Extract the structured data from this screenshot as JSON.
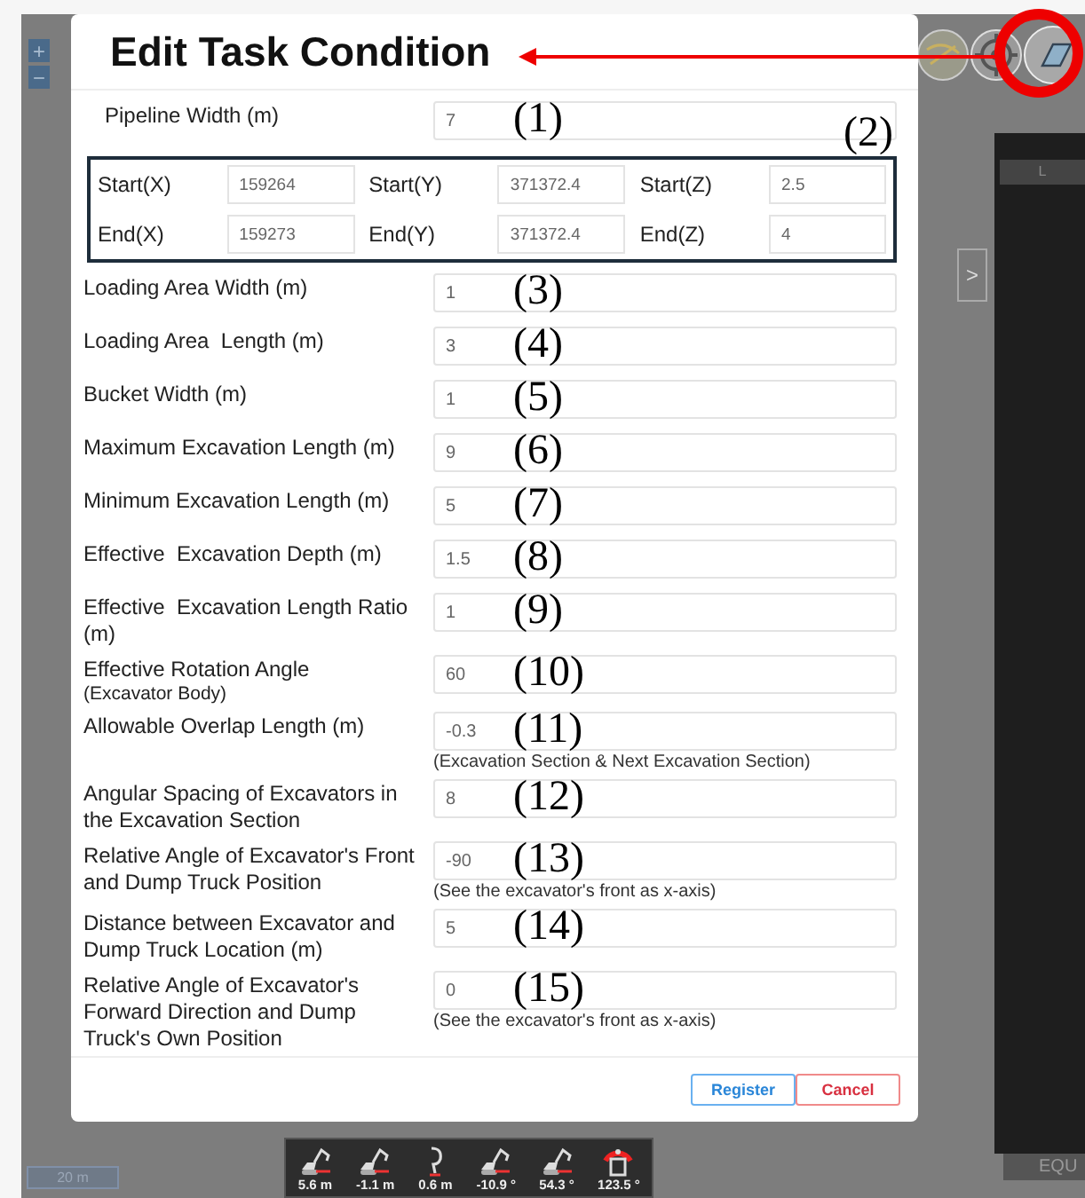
{
  "map": {
    "zoom_in": "+",
    "zoom_out": "−",
    "scale": "20 m",
    "side_tab": ">",
    "panel_header": "L",
    "panel_footer": "EQU"
  },
  "dialog": {
    "title": "Edit Task Condition",
    "pipeline": {
      "label": "Pipeline Width (m)",
      "value": "7",
      "annotation": "(1)"
    },
    "coordinates": {
      "annotation": "(2)",
      "rows": [
        [
          {
            "label": "Start(X)",
            "value": "159264"
          },
          {
            "label": "Start(Y)",
            "value": "371372.4"
          },
          {
            "label": "Start(Z)",
            "value": "2.5"
          }
        ],
        [
          {
            "label": "End(X)",
            "value": "159273"
          },
          {
            "label": "End(Y)",
            "value": "371372.4"
          },
          {
            "label": "End(Z)",
            "value": "4"
          }
        ]
      ]
    },
    "fields": [
      {
        "label": "Loading Area Width (m)",
        "value": "1",
        "annotation": "(3)"
      },
      {
        "label": "Loading Area  Length (m)",
        "value": "3",
        "annotation": "(4)"
      },
      {
        "label": "Bucket Width (m)",
        "value": "1",
        "annotation": "(5)"
      },
      {
        "label": "Maximum Excavation Length (m)",
        "value": "9",
        "annotation": "(6)"
      },
      {
        "label": "Minimum Excavation Length (m)",
        "value": "5",
        "annotation": "(7)"
      },
      {
        "label": "Effective  Excavation Depth (m)",
        "value": "1.5",
        "annotation": "(8)"
      },
      {
        "label": "Effective  Excavation Length Ratio (m)",
        "value": "1",
        "annotation": "(9)"
      },
      {
        "label": "Effective Rotation Angle",
        "sublabel": "(Excavator Body)",
        "value": "60",
        "annotation": "(10)"
      },
      {
        "label": "Allowable Overlap Length (m)",
        "value": "-0.3",
        "annotation": "(11)",
        "note": "(Excavation Section & Next Excavation Section)"
      },
      {
        "label": "Angular Spacing of Excavators in the Excavation Section",
        "value": "8",
        "annotation": "(12)"
      },
      {
        "label": "Relative Angle of Excavator's Front and Dump Truck Position",
        "value": "-90",
        "annotation": "(13)",
        "note": "(See the excavator's front as x-axis)"
      },
      {
        "label": "Distance between Excavator and Dump Truck Location (m)",
        "value": "5",
        "annotation": "(14)"
      },
      {
        "label": "Relative Angle of Excavator's Forward Direction and Dump Truck's Own Position",
        "value": "0",
        "annotation": "(15)",
        "note": "(See the excavator's front as x-axis)"
      }
    ],
    "buttons": [
      {
        "label": "Register",
        "kind": "primary"
      },
      {
        "label": "Cancel",
        "kind": "danger"
      }
    ]
  },
  "toolbar": [
    {
      "kind": "excavator",
      "value": "5.6 m"
    },
    {
      "kind": "excavator",
      "value": "-1.1 m"
    },
    {
      "kind": "bucket",
      "value": "0.6 m"
    },
    {
      "kind": "excavator",
      "value": "-10.9 °"
    },
    {
      "kind": "excavator",
      "value": "54.3 °"
    },
    {
      "kind": "swing",
      "value": "123.5 °"
    }
  ]
}
